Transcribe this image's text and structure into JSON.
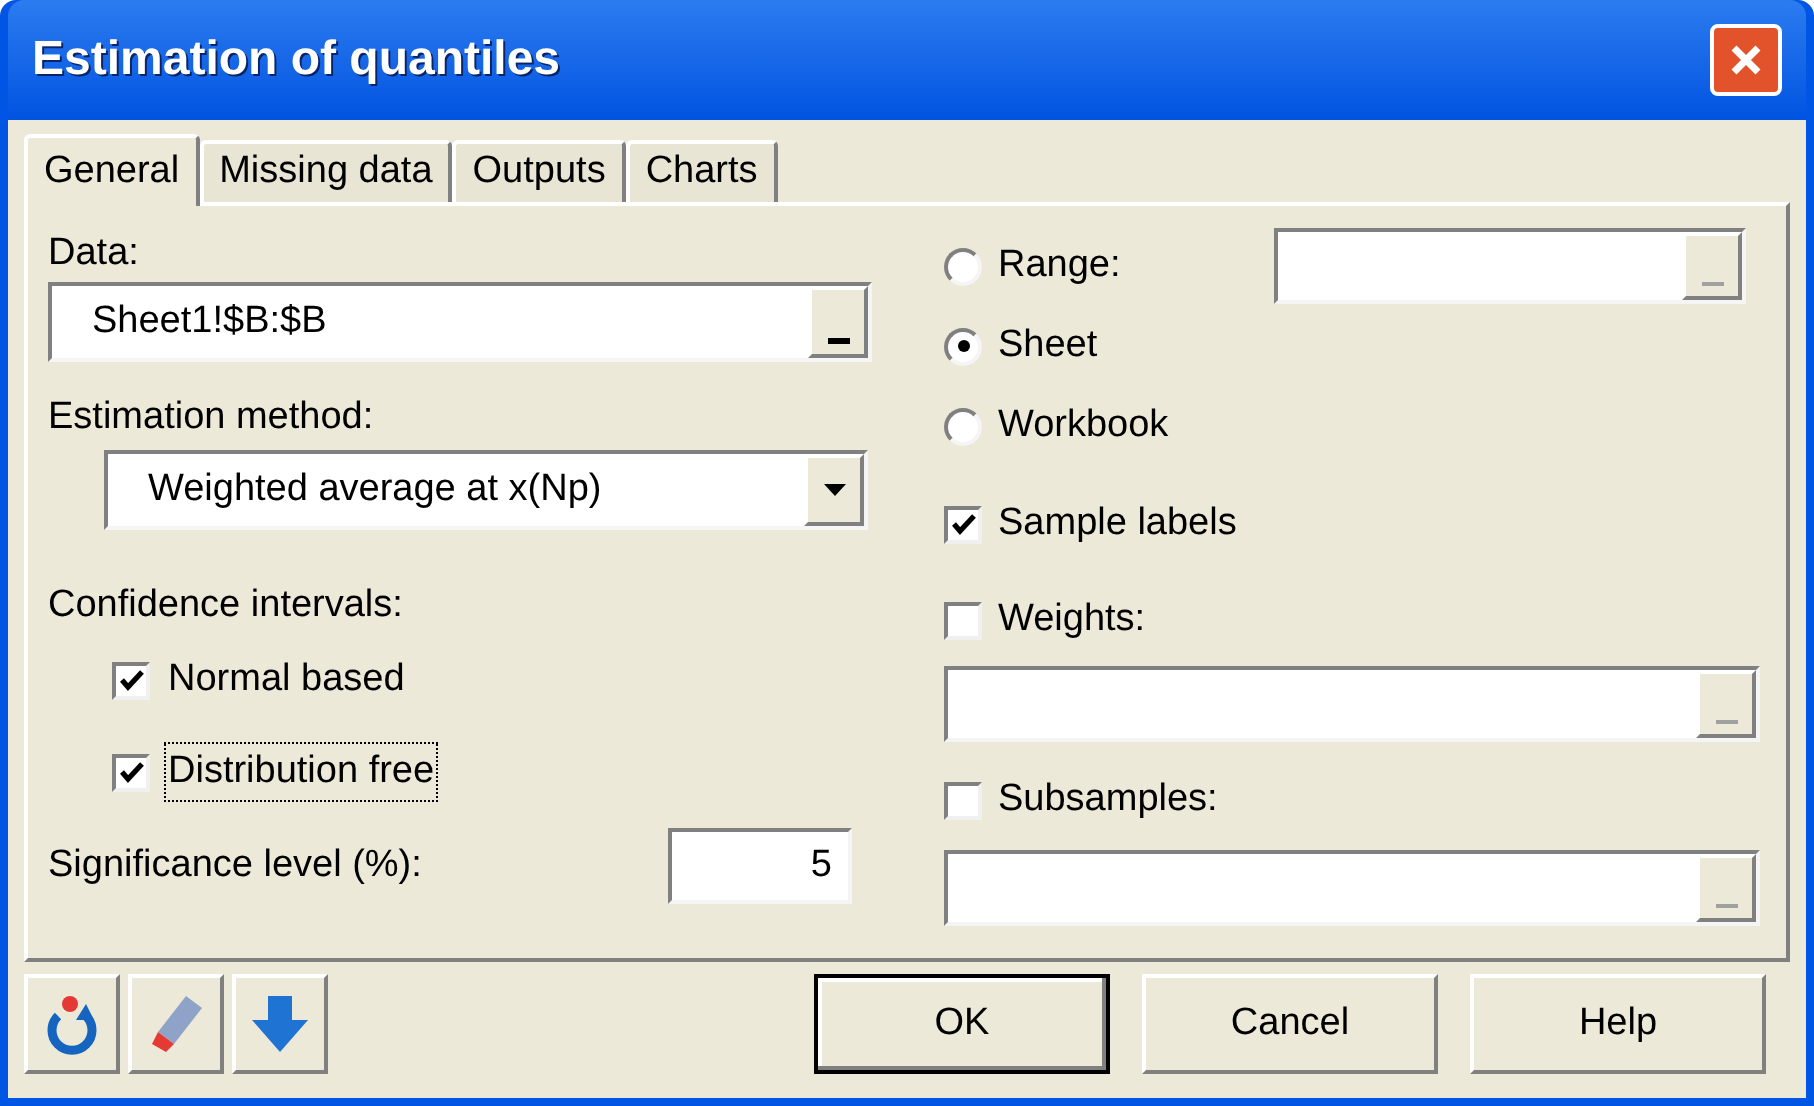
{
  "window": {
    "title": "Estimation of quantiles"
  },
  "tabs": [
    {
      "label": "General",
      "selected": true
    },
    {
      "label": "Missing data",
      "selected": false
    },
    {
      "label": "Outputs",
      "selected": false
    },
    {
      "label": "Charts",
      "selected": false
    }
  ],
  "data": {
    "label": "Data:",
    "value": "Sheet1!$B:$B"
  },
  "estimation_method": {
    "label": "Estimation method:",
    "value": "Weighted average at x(Np)"
  },
  "confidence_intervals": {
    "label": "Confidence intervals:",
    "options": [
      {
        "label": "Normal based",
        "checked": true,
        "focused": false
      },
      {
        "label": "Distribution free",
        "checked": true,
        "focused": true
      }
    ]
  },
  "significance_level": {
    "label": "Significance level (%):",
    "value": "5"
  },
  "scope": [
    {
      "label": "Range:",
      "selected": false
    },
    {
      "label": "Sheet",
      "selected": true
    },
    {
      "label": "Workbook",
      "selected": false
    }
  ],
  "sample_labels": {
    "label": "Sample labels",
    "checked": true
  },
  "weights": {
    "label": "Weights:",
    "checked": false
  },
  "subsamples": {
    "label": "Subsamples:",
    "checked": false
  },
  "buttons": [
    {
      "label": "OK",
      "default": true
    },
    {
      "label": "Cancel",
      "default": false
    },
    {
      "label": "Help",
      "default": false
    }
  ]
}
